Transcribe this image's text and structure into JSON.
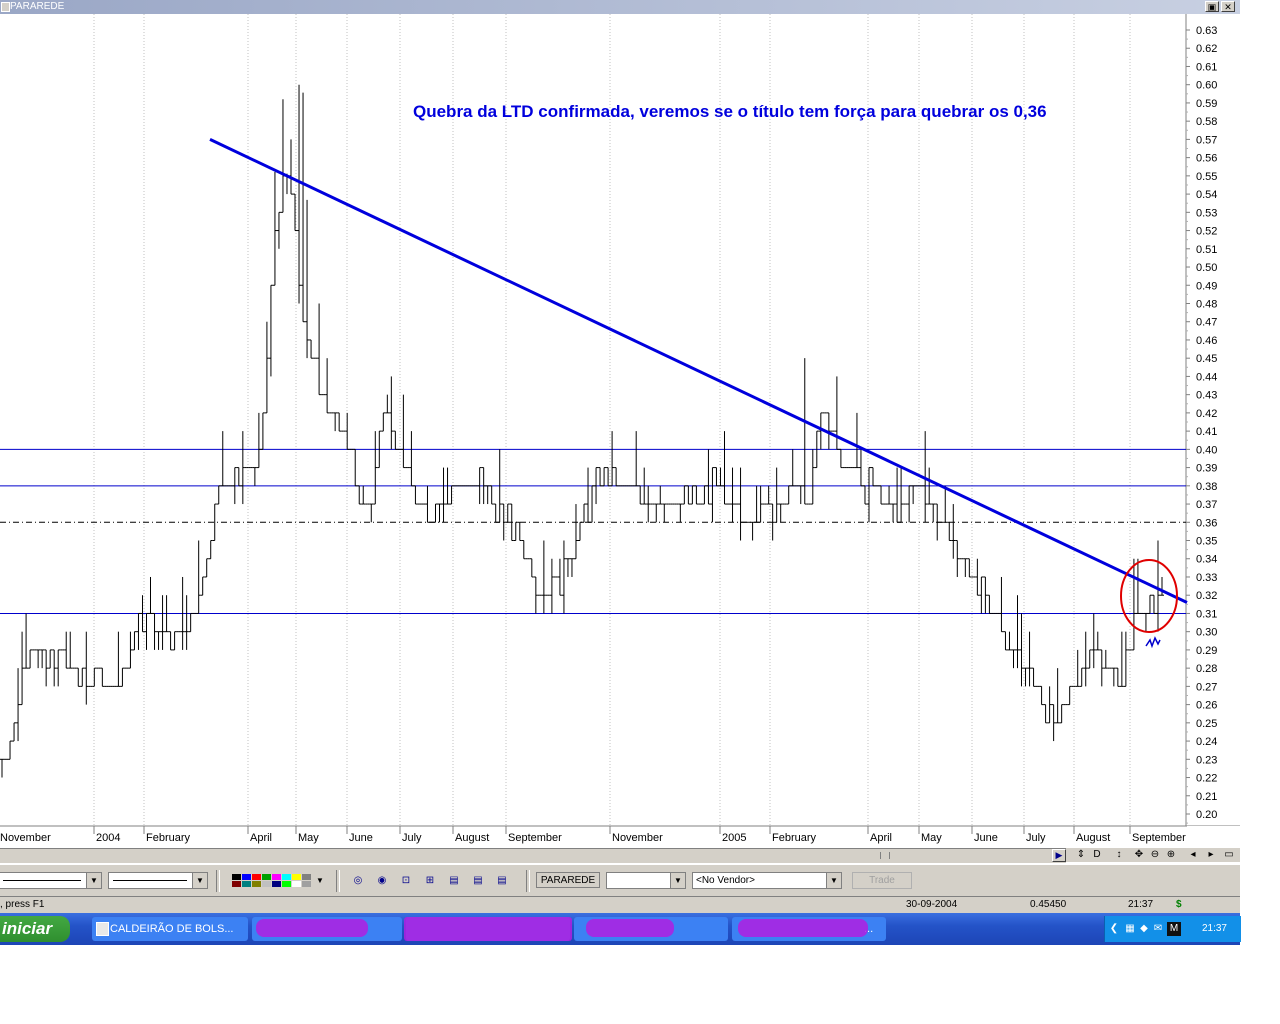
{
  "window": {
    "title": "PARAREDE",
    "restore_icon": "restore-icon",
    "close_icon": "close-icon"
  },
  "chart_data": {
    "type": "ohlc",
    "annotation": "Quebra da LTD confirmada, veremos se o título tem força para quebrar os 0,36",
    "y_ticks": [
      "0.63",
      "0.62",
      "0.61",
      "0.60",
      "0.59",
      "0.58",
      "0.57",
      "0.56",
      "0.55",
      "0.54",
      "0.53",
      "0.52",
      "0.51",
      "0.50",
      "0.49",
      "0.48",
      "0.47",
      "0.46",
      "0.45",
      "0.44",
      "0.43",
      "0.42",
      "0.41",
      "0.40",
      "0.39",
      "0.38",
      "0.37",
      "0.36",
      "0.35",
      "0.34",
      "0.33",
      "0.32",
      "0.31",
      "0.30",
      "0.29",
      "0.28",
      "0.27",
      "0.26",
      "0.25",
      "0.24",
      "0.23",
      "0.22",
      "0.21",
      "0.20"
    ],
    "ylim": [
      0.195,
      0.635
    ],
    "x_labels": [
      "November",
      "2004",
      "February",
      "April",
      "May",
      "June",
      "July",
      "August",
      "September",
      "November",
      "2005",
      "February",
      "April",
      "May",
      "June",
      "July",
      "August",
      "September"
    ],
    "support_resistance_levels": [
      0.4,
      0.38,
      0.31
    ],
    "dashed_level": 0.36,
    "trendline": {
      "from": {
        "date": "2004-03",
        "value": 0.57
      },
      "to": {
        "date": "2005-09",
        "value": 0.32
      }
    },
    "highlight": "circle around latest breakout",
    "colors": {
      "bars": "#000000",
      "trendline": "#0000dd",
      "levels": "#0000cc",
      "circle": "#e00000",
      "annotation": "#0000dd"
    },
    "price_path": [
      [
        0.23,
        0.24
      ],
      [
        0.25,
        0.26
      ],
      [
        0.3,
        0.31
      ],
      [
        0.28,
        0.27
      ],
      [
        0.29,
        0.27
      ],
      [
        0.28,
        0.28
      ],
      [
        0.27,
        0.27
      ],
      [
        0.28,
        0.26
      ],
      [
        0.27,
        0.27
      ],
      [
        0.28,
        0.28
      ],
      [
        0.31,
        0.32
      ],
      [
        0.31,
        0.3
      ],
      [
        0.3,
        0.29
      ],
      [
        0.3,
        0.29
      ],
      [
        0.31,
        0.31
      ],
      [
        0.34,
        0.37
      ],
      [
        0.38,
        0.4
      ],
      [
        0.38,
        0.37
      ],
      [
        0.39,
        0.4
      ],
      [
        0.4,
        0.43
      ],
      [
        0.52,
        0.58
      ],
      [
        0.56,
        0.5
      ],
      [
        0.47,
        0.43
      ],
      [
        0.44,
        0.42
      ],
      [
        0.42,
        0.41
      ],
      [
        0.41,
        0.4
      ],
      [
        0.38,
        0.37
      ],
      [
        0.37,
        0.42
      ],
      [
        0.43,
        0.41
      ],
      [
        0.4,
        0.39
      ],
      [
        0.38,
        0.37
      ],
      [
        0.37,
        0.37
      ],
      [
        0.37,
        0.36
      ],
      [
        0.38,
        0.38
      ],
      [
        0.38,
        0.37
      ],
      [
        0.39,
        0.38
      ],
      [
        0.37,
        0.36
      ],
      [
        0.36,
        0.35
      ],
      [
        0.35,
        0.34
      ],
      [
        0.33,
        0.32
      ],
      [
        0.32,
        0.31
      ],
      [
        0.33,
        0.34
      ],
      [
        0.35,
        0.36
      ],
      [
        0.37,
        0.38
      ],
      [
        0.39,
        0.38
      ],
      [
        0.38,
        0.37
      ],
      [
        0.38,
        0.38
      ],
      [
        0.37,
        0.38
      ],
      [
        0.38,
        0.37
      ],
      [
        0.37,
        0.38
      ],
      [
        0.38,
        0.37
      ],
      [
        0.37,
        0.37
      ],
      [
        0.38,
        0.38
      ],
      [
        0.37,
        0.37
      ],
      [
        0.37,
        0.38
      ],
      [
        0.36,
        0.37
      ],
      [
        0.37,
        0.38
      ],
      [
        0.37,
        0.38
      ],
      [
        0.38,
        0.37
      ],
      [
        0.37,
        0.37
      ],
      [
        0.42,
        0.41
      ],
      [
        0.4,
        0.39
      ],
      [
        0.39,
        0.39
      ],
      [
        0.38,
        0.38
      ],
      [
        0.38,
        0.37
      ],
      [
        0.37,
        0.36
      ],
      [
        0.37,
        0.38
      ],
      [
        0.38,
        0.37
      ],
      [
        0.37,
        0.36
      ],
      [
        0.36,
        0.35
      ],
      [
        0.34,
        0.33
      ],
      [
        0.33,
        0.33
      ],
      [
        0.32,
        0.31
      ],
      [
        0.3,
        0.29
      ],
      [
        0.29,
        0.28
      ],
      [
        0.28,
        0.27
      ],
      [
        0.26,
        0.25
      ],
      [
        0.25,
        0.25
      ],
      [
        0.26,
        0.27
      ],
      [
        0.28,
        0.29
      ],
      [
        0.29,
        0.28
      ],
      [
        0.28,
        0.27
      ],
      [
        0.27,
        0.28
      ],
      [
        0.31,
        0.32
      ],
      [
        0.31,
        0.31
      ],
      [
        0.32,
        0.33
      ]
    ]
  },
  "navbar": {
    "icons": [
      "refresh-icon",
      "d-icon",
      "updown-icon",
      "move-icon",
      "zoom-out-icon",
      "zoom-in-icon",
      "left-icon",
      "right-icon",
      "window-icon"
    ],
    "glyphs": [
      "⇕",
      "D",
      "↕",
      "✥",
      "⊖",
      "⊕",
      "◂",
      "▸",
      "▭"
    ]
  },
  "toolbar": {
    "symbol": "PARAREDE",
    "vendor": "<No Vendor>",
    "trade_label": "Trade",
    "swatch_colors": [
      "#000000",
      "#0000ff",
      "#ff0000",
      "#00a000",
      "#ff00ff",
      "#00ffff",
      "#ffff00",
      "#808080",
      "#800000",
      "#008080",
      "#808000",
      "#c0c0c0",
      "#000080",
      "#00ff00",
      "#ffffff",
      "#a0a0a0"
    ]
  },
  "statusbar": {
    "help": ", press F1",
    "date": "30-09-2004",
    "value": "0.45450",
    "time": "21:37",
    "dollar": "$"
  },
  "taskbar": {
    "start_label": "iniciar",
    "task1": "CALDEIRÃO DE BOLS...",
    "task2": "...",
    "clock": "21:37"
  }
}
